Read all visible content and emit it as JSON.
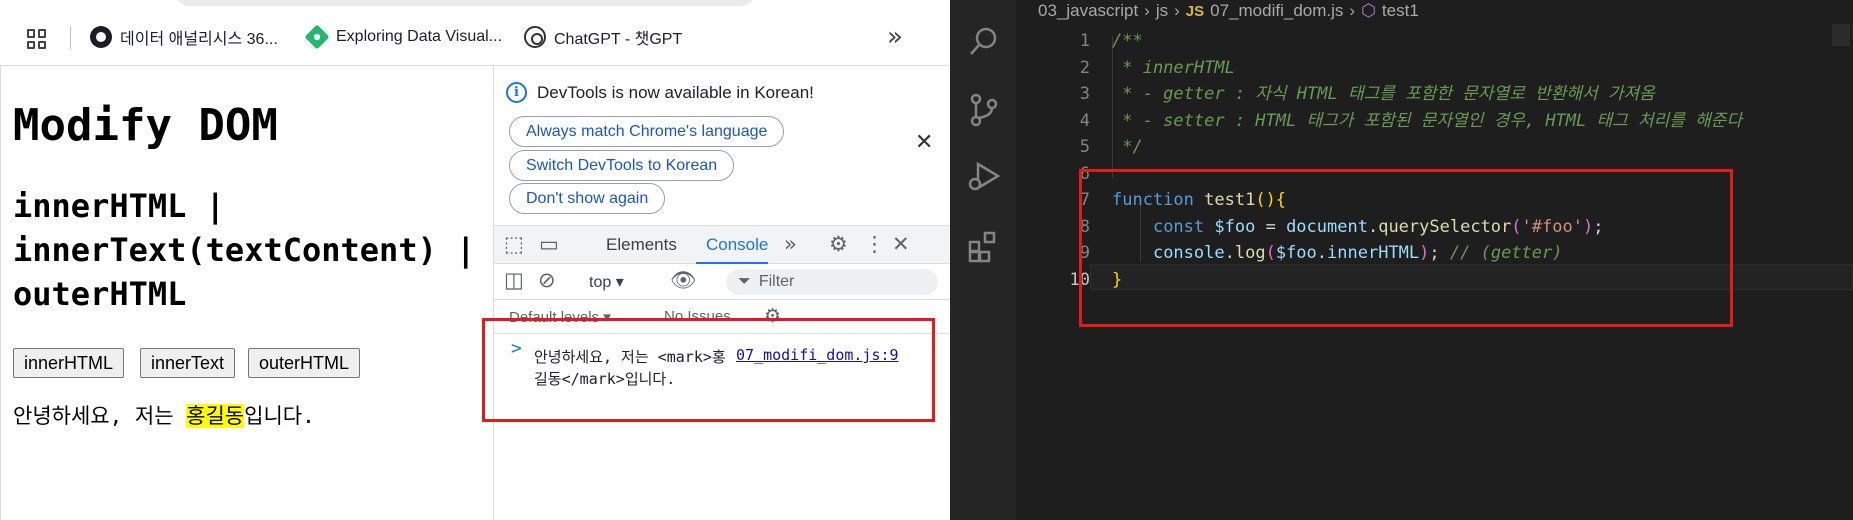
{
  "bookmarks": {
    "items": [
      {
        "label": "데이터 애널리시스 36...",
        "icon": "github-icon"
      },
      {
        "label": "Exploring Data Visual...",
        "icon": "exploring-data-icon"
      },
      {
        "label": "ChatGPT - 챗GPT",
        "icon": "chatgpt-icon"
      }
    ],
    "more": "»"
  },
  "page": {
    "title": "Modify DOM",
    "subtitle": "innerHTML | innerText(textContent) | outerHTML",
    "buttons": [
      "innerHTML",
      "innerText",
      "outerHTML"
    ],
    "foo": {
      "before": "안녕하세요, 저는 ",
      "marked": "홍길동",
      "after": "입니다."
    }
  },
  "devtools": {
    "notice": "DevTools is now available in Korean!",
    "pills": [
      "Always match Chrome's language",
      "Switch DevTools to Korean",
      "Don't show again"
    ],
    "tabs": {
      "elements": "Elements",
      "console": "Console"
    },
    "context": "top",
    "filter_placeholder": "Filter",
    "levels": "Default levels",
    "issues": "No Issues",
    "console_message": "안녕하세요, 저는 <mark>홍길동</mark>입니다.",
    "console_source": "07_modifi_dom.js:9",
    "prompt": ">"
  },
  "vscode": {
    "breadcrumb": [
      "03_javascript",
      "js",
      "07_modifi_dom.js",
      "test1"
    ],
    "breadcrumb_file_badge": "JS",
    "line_numbers": [
      "1",
      "2",
      "3",
      "4",
      "5",
      "6",
      "7",
      "8",
      "9",
      "10"
    ],
    "active_line": "10",
    "code": {
      "l1": "/**",
      "l2": " * innerHTML",
      "l3": " * - getter : 자식 HTML 태그를 포함한 문자열로 반환해서 가져옴",
      "l4": " * - setter : HTML 태그가 포함된 문자열인 경우, HTML 태그 처리를 해준다",
      "l5": " */",
      "l7_kw": "function",
      "l7_name": "test1",
      "l8_kw": "const",
      "l8_var": "$foo",
      "l8_obj": "document",
      "l8_method": "querySelector",
      "l8_arg": "'#foo'",
      "l9_obj": "console",
      "l9_method": "log",
      "l9_var": "$foo",
      "l9_prop": "innerHTML",
      "l9_comment": "// (getter)"
    }
  },
  "colors": {
    "highlight_border": "#e21b1b",
    "console_tab_accent": "#1a73e8",
    "mark_yellow": "#ffff00"
  }
}
